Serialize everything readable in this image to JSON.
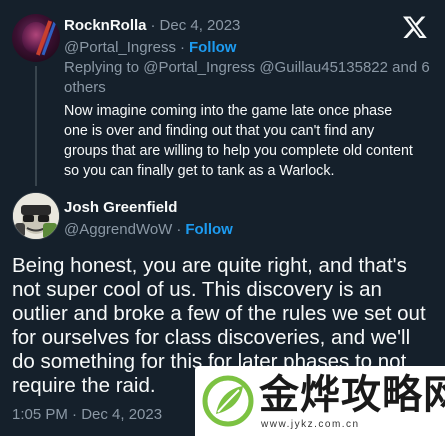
{
  "reply_tweet": {
    "display_name": "RocknRolla",
    "date": "Dec 4, 2023",
    "handle": "@Portal_Ingress",
    "follow_label": "Follow",
    "replying_prefix": "Replying to",
    "replying_mentions": "@Portal_Ingress @Guillau45135822",
    "replying_suffix": "and 6 others",
    "text": "Now imagine coming into the game late once phase one is over and finding out that you can't find any groups that are willing to help you complete old content so you can finally get to tank as a Warlock."
  },
  "main_tweet": {
    "display_name": "Josh Greenfield",
    "handle": "@AggrendWoW",
    "follow_label": "Follow",
    "text": "Being honest, you are quite right, and that's not super cool of us. This discovery is an outlier and broke a few of the rules we set out for ourselves for class discoveries, and we'll do something for this for later phases to not require the raid.",
    "timestamp": "1:05 PM · Dec 4, 2023"
  },
  "separator": "·",
  "watermark": {
    "text": "金烨攻略网",
    "url": "www.jykz.com.cn"
  },
  "colors": {
    "background": "#15202b",
    "primary_text": "#f7f9f9",
    "secondary_text": "#8b98a5",
    "accent": "#1d9bf0",
    "watermark_green": "#7cc242"
  },
  "icons": {
    "brand": "x-logo-icon"
  }
}
